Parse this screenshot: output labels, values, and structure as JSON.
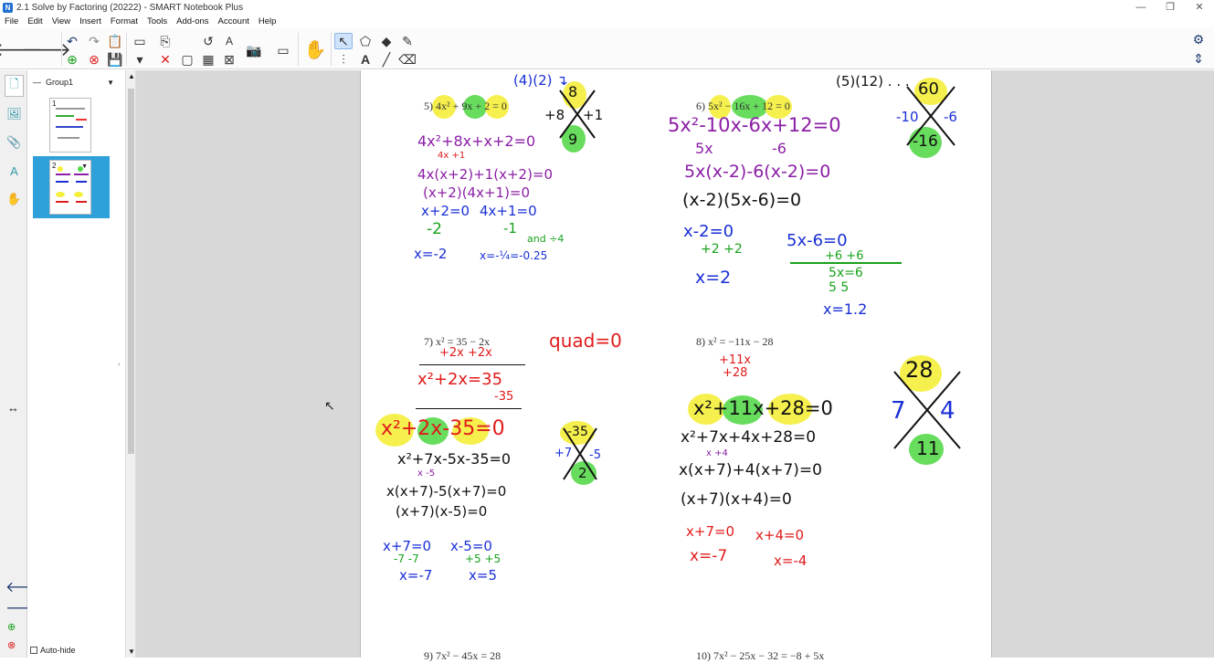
{
  "window": {
    "title": "2.1  Solve by Factoring (20222) - SMART Notebook Plus",
    "icon": "notebook-app-icon"
  },
  "window_controls": [
    "—",
    "❐",
    "✕"
  ],
  "menu": [
    "File",
    "Edit",
    "View",
    "Insert",
    "Format",
    "Tools",
    "Add-ons",
    "Account",
    "Help"
  ],
  "sorter": {
    "group_label": "Group1",
    "pages": [
      "1",
      "2"
    ],
    "selected_page": "2",
    "autohide_label": "Auto-hide"
  },
  "problems": {
    "p5": "5)  4x² + 9x + 2 = 0",
    "p6": "6)  5x² − 16x + 12 = 0",
    "p7": "7)  x² = 35 − 2x",
    "p8": "8)  x² = −11x − 28",
    "p9": "9)  7x² − 45x = 28",
    "p10": "10)  7x² − 25x − 32 = −8 + 5x"
  },
  "handwriting": {
    "p5": {
      "top": "(4)(2) ↴",
      "x_top": "8",
      "x_left": "+8",
      "x_right": "+1",
      "x_bottom": "9",
      "l1": "4x²+8x+x+2=0",
      "l1_sub": "4x       +1",
      "l2": "4x(x+2)+1(x+2)=0",
      "l3": "(x+2)(4x+1)=0",
      "l4a": "x+2=0",
      "l4b": "4x+1=0",
      "l5a": "-2",
      "l5b": "-1",
      "l6a": "x=-2",
      "l6b": "x=-¼=-0.25",
      "note": "and ÷4"
    },
    "p6": {
      "top": "(5)(12) . . .",
      "x_top": "60",
      "x_left": "-10",
      "x_right": "-6",
      "x_bottom": "-16",
      "l1": "5x²-10x-6x+12=0",
      "l1_sub_a": "5x",
      "l1_sub_b": "-6",
      "l2": "5x(x-2)-6(x-2)=0",
      "l3": "(x-2)(5x-6)=0",
      "l4a": "x-2=0",
      "l4b": "5x-6=0",
      "l5a": "+2  +2",
      "l5b": "+6  +6",
      "l6a": "x=2",
      "l6b": "5x=6",
      "l6c": "5     5",
      "l7": "x=1.2"
    },
    "p7": {
      "note": "quad=0",
      "l1": "+2x   +2x",
      "l2": "x²+2x=35",
      "l3": "-35",
      "l4": "x²+2x-35=0",
      "x_top": "-35",
      "x_left": "+7",
      "x_right": "-5",
      "x_bottom": "2",
      "l5": "x²+7x-5x-35=0",
      "l5_sub": "x          -5",
      "l6": "x(x+7)-5(x+7)=0",
      "l7": "(x+7)(x-5)=0",
      "l8a": "x+7=0",
      "l8b": "x-5=0",
      "l9a": "-7  -7",
      "l9b": "+5  +5",
      "l10a": "x=-7",
      "l10b": "x=5"
    },
    "p8": {
      "l1": "+11x",
      "l2": "+28",
      "l3": "x²+11x+28=0",
      "x_top": "28",
      "x_left": "7",
      "x_right": "4",
      "x_bottom": "11",
      "l4": "x²+7x+4x+28=0",
      "l4_sub": "x          +4",
      "l5": "x(x+7)+4(x+7)=0",
      "l6": "(x+7)(x+4)=0",
      "l7a": "x+7=0",
      "l7b": "x+4=0",
      "l8a": "x=-7",
      "l8b": "x=-4"
    }
  },
  "colors": {
    "blue": "#1a2fd6",
    "green": "#18a21b",
    "red": "#e01b1b",
    "purple": "#8b1fa6",
    "highlight_yellow": "#f5ee3b",
    "highlight_green": "#57d84b",
    "selection_blue": "#2ea0da"
  }
}
